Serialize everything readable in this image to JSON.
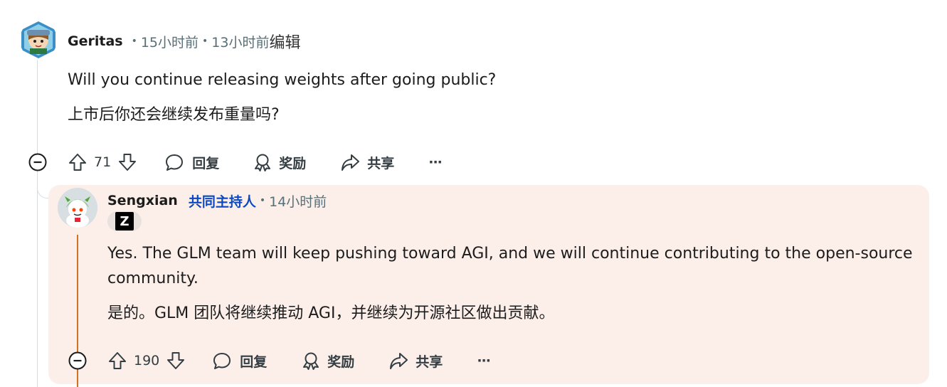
{
  "comment1": {
    "author": "Geritas",
    "posted_ago": "15小时前",
    "edited_ago": "13小时前",
    "edited_label": "编辑",
    "text_en": "Will you continue releasing weights after going public?",
    "text_zh": "上市后你还会继续发布重量吗?",
    "votes": "71",
    "reply_label": "回复",
    "award_label": "奖励",
    "share_label": "共享",
    "more_label": "···"
  },
  "comment2": {
    "author": "Sengxian",
    "role": "共同主持人",
    "posted_ago": "14小时前",
    "flair": "Z",
    "text_en": "Yes. The GLM team will keep pushing toward AGI, and we will continue contributing to the open-source community.",
    "text_zh": "是的。GLM 团队将继续推动 AGI，并继续为开源社区做出贡献。",
    "votes": "190",
    "reply_label": "回复",
    "award_label": "奖励",
    "share_label": "共享",
    "more_label": "···"
  },
  "colors": {
    "moderator": "#0a49c1",
    "op_thread": "#d2711f",
    "highlight_bg": "#fcefea"
  },
  "icons": [
    "collapse-icon",
    "upvote-icon",
    "downvote-icon",
    "reply-icon",
    "award-icon",
    "share-icon",
    "more-icon"
  ]
}
